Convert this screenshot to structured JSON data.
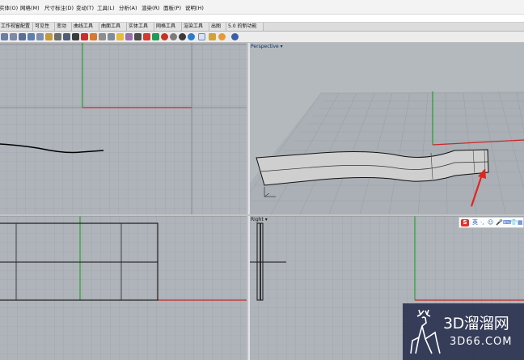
{
  "menu": [
    {
      "label": "实体(O)"
    },
    {
      "label": "网格(M)"
    },
    {
      "label": "尺寸标注(D)"
    },
    {
      "label": "变动(T)"
    },
    {
      "label": "工具(L)"
    },
    {
      "label": "分析(A)"
    },
    {
      "label": "渲染(R)"
    },
    {
      "label": "面板(P)"
    },
    {
      "label": "说明(H)"
    }
  ],
  "tabs": [
    {
      "label": "工作视窗配置"
    },
    {
      "label": "可见性"
    },
    {
      "label": "变动"
    },
    {
      "label": "曲线工具"
    },
    {
      "label": "曲面工具"
    },
    {
      "label": "实体工具"
    },
    {
      "label": "网格工具"
    },
    {
      "label": "渲染工具"
    },
    {
      "label": "出图"
    },
    {
      "label": "5.0 的新功能"
    }
  ],
  "viewports": {
    "perspective_label": "Perspective",
    "right_label": "Right"
  },
  "ime_logo": "S",
  "ime_items": [
    "英",
    "·,",
    "☺",
    "🎤",
    "⌨",
    "👕",
    "▦"
  ],
  "watermark": {
    "title": "3D溜溜网",
    "url": "3D66.COM"
  },
  "colors": {
    "grid_bg": "#aeb4b9",
    "grid_line": "#9aa0a6",
    "axis_red": "#c8282c",
    "axis_green": "#2aa032",
    "arrow_red": "#e3241c"
  }
}
